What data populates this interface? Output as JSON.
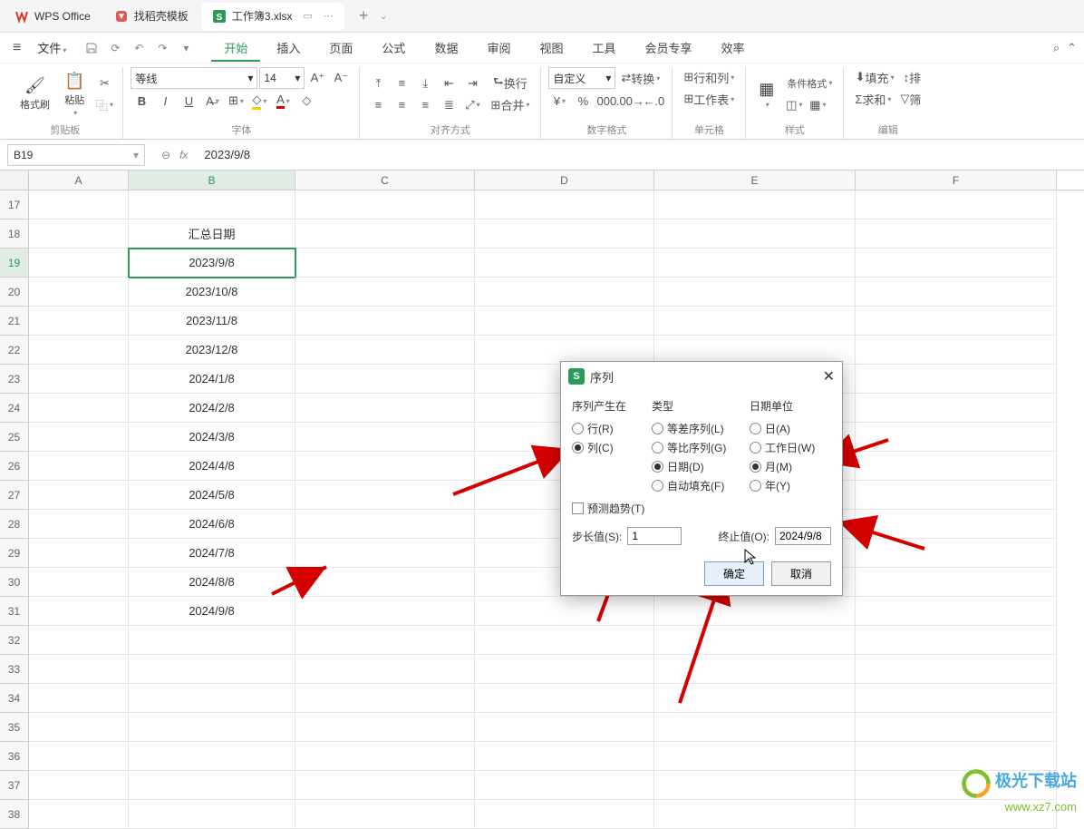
{
  "tabs": {
    "wps": "WPS Office",
    "template": "找稻壳模板",
    "file": "工作簿3.xlsx"
  },
  "menu": {
    "file": "文件",
    "items": [
      "开始",
      "插入",
      "页面",
      "公式",
      "数据",
      "审阅",
      "视图",
      "工具",
      "会员专享",
      "效率"
    ]
  },
  "ribbon": {
    "clipboard": {
      "format_painter": "格式刷",
      "paste": "粘贴",
      "group": "剪贴板"
    },
    "font": {
      "name": "等线",
      "size": "14",
      "group": "字体"
    },
    "align": {
      "wrap": "换行",
      "merge": "合并",
      "group": "对齐方式"
    },
    "number": {
      "format": "自定义",
      "group": "数字格式"
    },
    "cells": {
      "convert": "转换",
      "rowcol": "行和列",
      "worksheet": "工作表",
      "group": "单元格"
    },
    "style": {
      "cond": "条件格式",
      "group": "样式"
    },
    "edit": {
      "fill": "填充",
      "sum": "求和",
      "sort": "排",
      "filter": "筛",
      "group": "编辑"
    }
  },
  "name_box": "B19",
  "formula": "2023/9/8",
  "columns": [
    "A",
    "B",
    "C",
    "D",
    "E",
    "F"
  ],
  "rows": [
    {
      "n": "17",
      "b": ""
    },
    {
      "n": "18",
      "b": "汇总日期"
    },
    {
      "n": "19",
      "b": "2023/9/8",
      "active": true
    },
    {
      "n": "20",
      "b": "2023/10/8"
    },
    {
      "n": "21",
      "b": "2023/11/8"
    },
    {
      "n": "22",
      "b": "2023/12/8"
    },
    {
      "n": "23",
      "b": "2024/1/8"
    },
    {
      "n": "24",
      "b": "2024/2/8"
    },
    {
      "n": "25",
      "b": "2024/3/8"
    },
    {
      "n": "26",
      "b": "2024/4/8"
    },
    {
      "n": "27",
      "b": "2024/5/8"
    },
    {
      "n": "28",
      "b": "2024/6/8"
    },
    {
      "n": "29",
      "b": "2024/7/8"
    },
    {
      "n": "30",
      "b": "2024/8/8"
    },
    {
      "n": "31",
      "b": "2024/9/8"
    },
    {
      "n": "32",
      "b": ""
    },
    {
      "n": "33",
      "b": ""
    },
    {
      "n": "34",
      "b": ""
    },
    {
      "n": "35",
      "b": ""
    },
    {
      "n": "36",
      "b": ""
    },
    {
      "n": "37",
      "b": ""
    },
    {
      "n": "38",
      "b": ""
    }
  ],
  "dialog": {
    "title": "序列",
    "groups": {
      "series_in": "序列产生在",
      "type": "类型",
      "date_unit": "日期单位"
    },
    "series_in": {
      "row": "行(R)",
      "col": "列(C)"
    },
    "type": {
      "linear": "等差序列(L)",
      "growth": "等比序列(G)",
      "date": "日期(D)",
      "autofill": "自动填充(F)"
    },
    "date_unit": {
      "day": "日(A)",
      "weekday": "工作日(W)",
      "month": "月(M)",
      "year": "年(Y)"
    },
    "trend": "预测趋势(T)",
    "step_label": "步长值(S):",
    "step_value": "1",
    "stop_label": "终止值(O):",
    "stop_value": "2024/9/8",
    "ok": "确定",
    "cancel": "取消"
  },
  "watermark": {
    "name": "极光下载站",
    "url": "www.xz7.com"
  }
}
